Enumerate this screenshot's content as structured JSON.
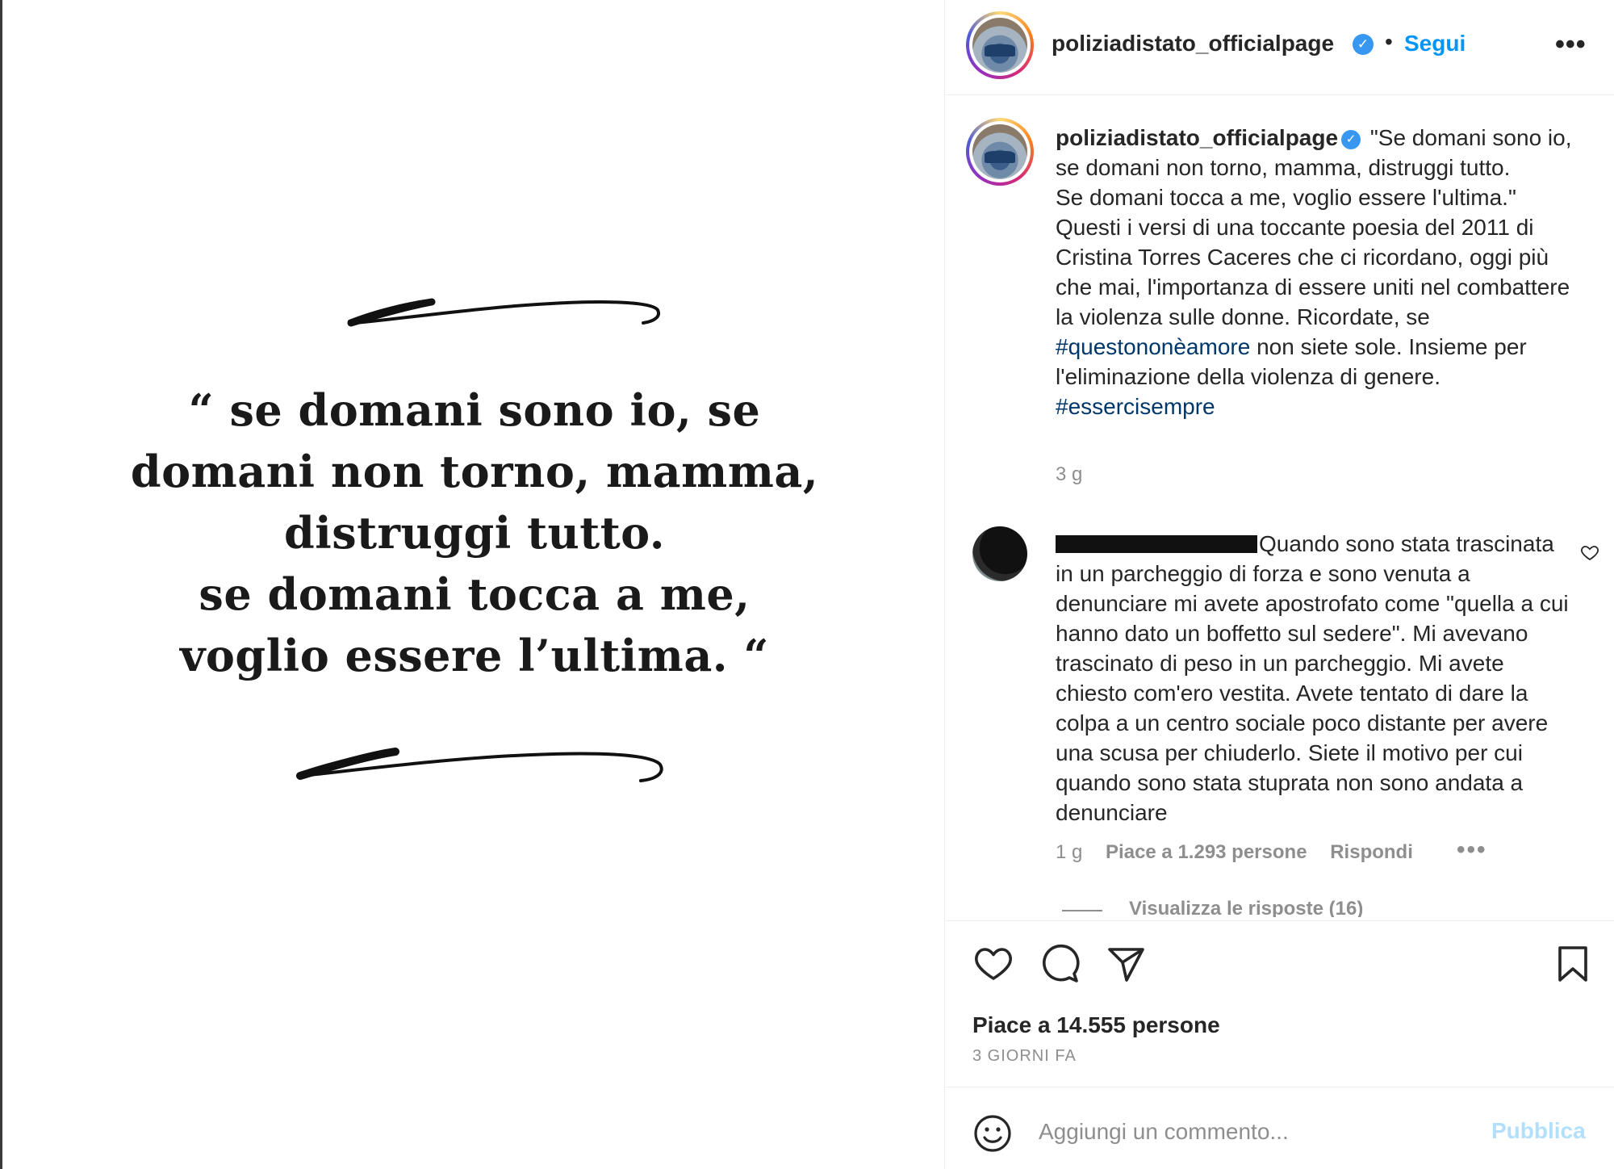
{
  "post": {
    "quote_lines": [
      "“ se domani sono io, se",
      "domani non torno, mamma,",
      "distruggi tutto.",
      "se domani tocca a me,",
      "voglio essere l’ultima. “"
    ]
  },
  "header": {
    "username": "poliziadistato_officialpage",
    "separator": "•",
    "follow_label": "Segui",
    "more_label": "•••"
  },
  "caption": {
    "username": "poliziadistato_officialpage",
    "text_part1": "\"Se domani sono io, se domani non torno, mamma, distruggi tutto.",
    "text_part2": "Se domani tocca a me, voglio essere l'ultima.\" Questi i versi di una toccante poesia del 2011 di Cristina Torres Caceres che ci ricordano, oggi più che mai, l'importanza di essere uniti nel combattere la violenza sulle donne. Ricordate, se",
    "hashtag1": "#questononèamore",
    "text_part3": "non siete sole. Insieme per l'eliminazione della violenza di genere.",
    "hashtag2": "#essercisempre",
    "time": "3 g"
  },
  "comment": {
    "text": "Quando sono stata trascinata in un parcheggio di forza e sono venuta a denunciare mi avete apostrofato come \"quella a cui hanno dato un boffetto sul sedere\". Mi avevano trascinato di peso in un parcheggio. Mi avete chiesto com'ero vestita. Avete tentato di dare la colpa a un centro sociale poco distante per avere una scusa per chiuderlo. Siete il motivo per cui quando sono stata stuprata non sono andata a denunciare",
    "time": "1 g",
    "likes": "Piace a 1.293 persone",
    "reply_label": "Rispondi",
    "more_label": "•••",
    "view_replies": "Visualizza le risposte (16)"
  },
  "footer": {
    "likes": "Piace a 14.555 persone",
    "posted": "3 GIORNI FA",
    "comment_placeholder": "Aggiungi un commento...",
    "publish_label": "Pubblica"
  },
  "colors": {
    "accent": "#0095f6",
    "hashtag": "#00376b",
    "muted": "#8e8e8e",
    "verified": "#3897f0"
  }
}
